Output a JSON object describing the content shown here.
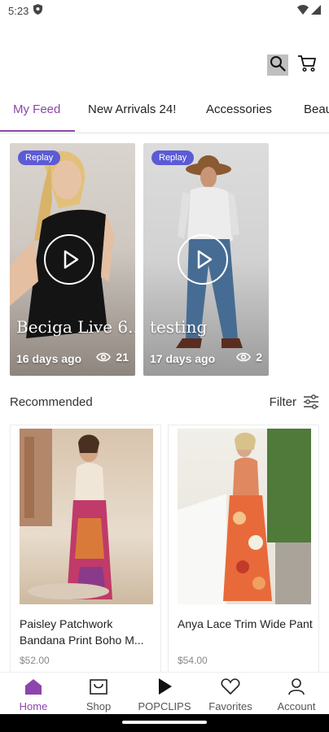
{
  "status_bar": {
    "time": "5:23"
  },
  "tabs": [
    {
      "label": "My Feed",
      "active": true
    },
    {
      "label": "New Arrivals 24!"
    },
    {
      "label": "Accessories"
    },
    {
      "label": "Beau"
    }
  ],
  "videos": [
    {
      "badge": "Replay",
      "title": "Beciga Live 6..",
      "ago": "16 days ago",
      "views": "21"
    },
    {
      "badge": "Replay",
      "title": "testing",
      "ago": "17 days ago",
      "views": "2"
    }
  ],
  "recommended": {
    "title": "Recommended",
    "filter_label": "Filter"
  },
  "products": [
    {
      "name": "Paisley Patchwork Bandana Print Boho M...",
      "price": "$52.00"
    },
    {
      "name": "Anya Lace Trim Wide Pant",
      "price": "$54.00"
    }
  ],
  "bottom_nav": [
    {
      "label": "Home",
      "icon": "home-icon",
      "active": true
    },
    {
      "label": "Shop",
      "icon": "shop-icon"
    },
    {
      "label": "POPCLIPS",
      "icon": "play-icon"
    },
    {
      "label": "Favorites",
      "icon": "heart-icon"
    },
    {
      "label": "Account",
      "icon": "person-icon"
    }
  ],
  "colors": {
    "accent": "#8e44ad",
    "badge": "#5b5bd6"
  }
}
